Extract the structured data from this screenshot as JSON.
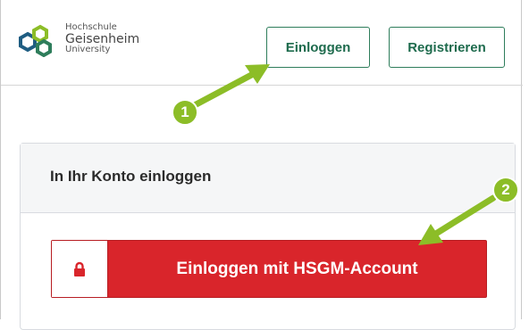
{
  "logo": {
    "line1": "Hochschule",
    "line2": "Geisenheim",
    "line3": "University"
  },
  "header": {
    "login_label": "Einloggen",
    "register_label": "Registrieren"
  },
  "card": {
    "title": "In Ihr Konto einloggen",
    "hsgm_button_label": "Einloggen mit HSGM-Account",
    "lock_icon": "lock-icon"
  },
  "annotations": {
    "step1": "1",
    "step2": "2"
  },
  "colors": {
    "brand_green": "#2e7d5b",
    "action_red": "#d9252b",
    "annotation_green": "#8cbd27"
  }
}
